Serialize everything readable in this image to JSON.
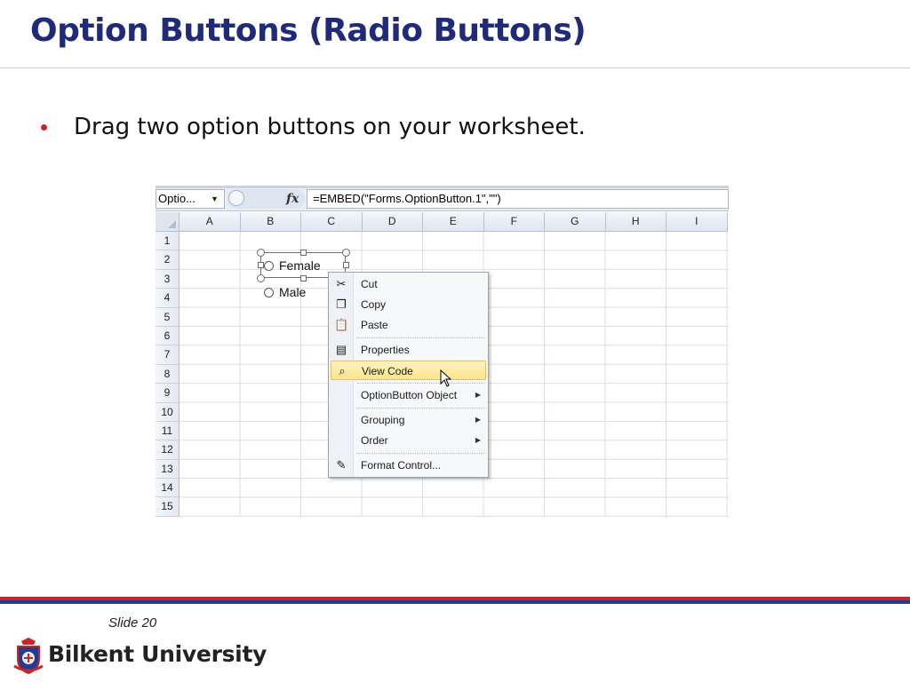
{
  "slide": {
    "title": "Option Buttons (Radio Buttons)",
    "bullet": "Drag two option buttons on your worksheet.",
    "slide_number": "Slide 20",
    "university": "Bilkent University"
  },
  "excel": {
    "name_box": "Optio...",
    "fx_label": "fx",
    "formula": "=EMBED(\"Forms.OptionButton.1\",\"\")",
    "columns": [
      "A",
      "B",
      "C",
      "D",
      "E",
      "F",
      "G",
      "H",
      "I"
    ],
    "rows": [
      "1",
      "2",
      "3",
      "4",
      "5",
      "6",
      "7",
      "8",
      "9",
      "10",
      "11",
      "12",
      "13",
      "14",
      "15"
    ],
    "option_buttons": {
      "female": "Female",
      "male": "Male"
    },
    "context_menu": {
      "cut": "Cut",
      "copy": "Copy",
      "paste": "Paste",
      "properties": "Properties",
      "view_code": "View Code",
      "optionbutton_object": "OptionButton Object",
      "grouping": "Grouping",
      "order": "Order",
      "format_control": "Format Control..."
    }
  },
  "colors": {
    "title": "#1f2a7a",
    "bullet": "#c0262d",
    "footer_red": "#c8242b",
    "footer_blue": "#243b8f",
    "menu_highlight": "#fde58a"
  }
}
